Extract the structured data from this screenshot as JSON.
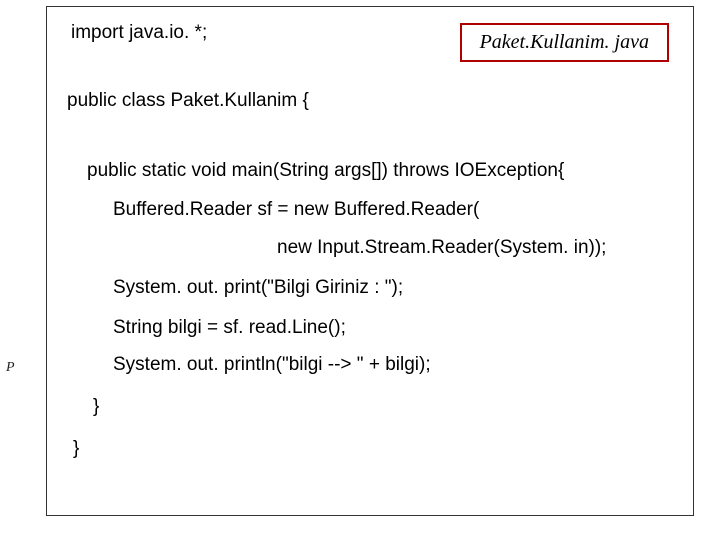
{
  "file_label": "Paket.Kullanim. java",
  "side_marker": "P",
  "code": {
    "l1": "import java.io. *;",
    "l2": "public class Paket.Kullanim {",
    "l3": "public static void main(String args[]) throws IOException{",
    "l4": "Buffered.Reader sf = new Buffered.Reader(",
    "l5": "new Input.Stream.Reader(System. in));",
    "l6": "System. out. print(\"Bilgi Giriniz : \");",
    "l7": "String bilgi = sf. read.Line();",
    "l8": "System. out. println(\"bilgi --> \" + bilgi);",
    "l9": "}",
    "l10": "}"
  }
}
